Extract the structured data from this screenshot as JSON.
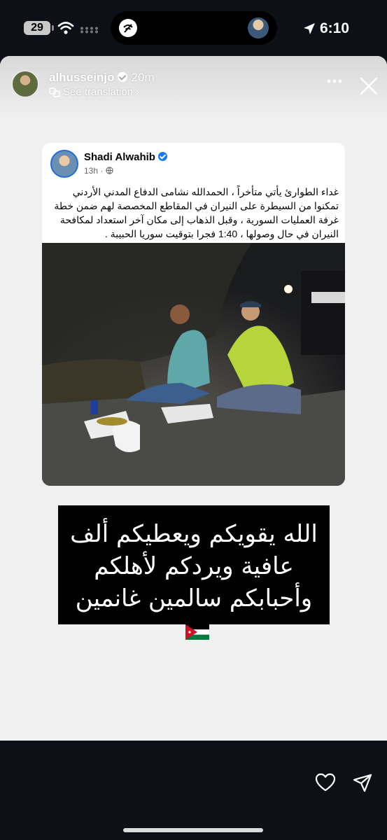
{
  "status_bar": {
    "battery": "29",
    "time": "6:10"
  },
  "story": {
    "username": "alhusseinjo",
    "time_ago": "20m",
    "see_translation": "See translation"
  },
  "post": {
    "author": "Shadi Alwahib",
    "meta": "13h ·",
    "text": "غداء الطوارئ يأتي متأخراً ، الحمدالله نشامى الدفاع المدني الأردني تمكنوا من السيطرة على النيران في المقاطع المخصصة لهم ضمن خطة غرفة العمليات السورية ، وقبل الذهاب إلى مكان آخر استعداد لمكافحة النيران في حال وصولها ، 1:40 فجرا بتوقيت سوريا الحبيبة ."
  },
  "dua": {
    "line1": "الله يقويكم ويعطيكم ألف",
    "line2": "عافية ويردكم لأهلكم",
    "line3": "وأحبابكم سالمين غانمين"
  },
  "icons": [
    "battery-icon",
    "wifi-icon",
    "signal-dots-icon",
    "location-arrow-icon",
    "verified-icon",
    "translate-icon",
    "more-icon",
    "close-icon",
    "globe-icon",
    "jordan-flag-icon",
    "heart-icon",
    "send-icon"
  ],
  "colors": {
    "background": "#0d1117",
    "story_card": "#f0f0f0",
    "facebook_blue": "#1877f2"
  }
}
